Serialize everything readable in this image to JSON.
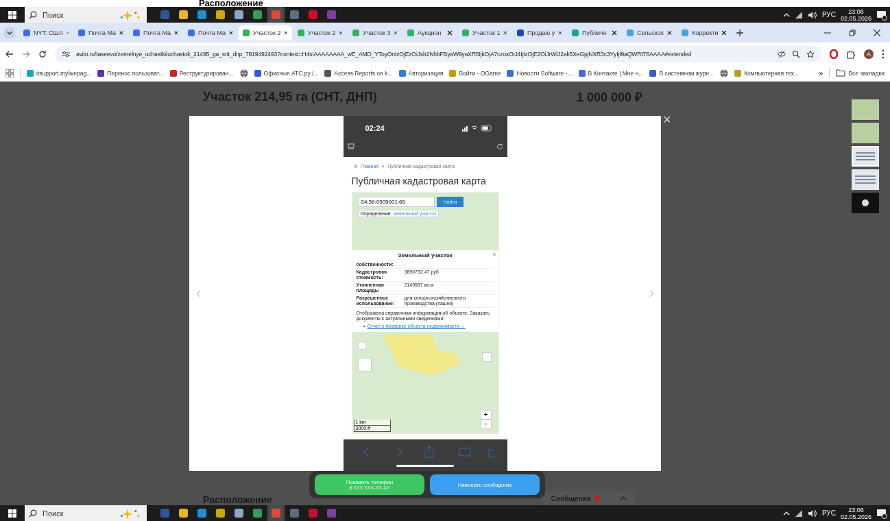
{
  "top_strip": {
    "heading": "Расположение"
  },
  "taskbars": [
    {
      "search_placeholder": "Поиск",
      "language": "РУС",
      "time": "23:06",
      "date": "02.05.2026",
      "apps": [
        {
          "color": "#2b5797",
          "selected": false
        },
        {
          "color": "#e8b62c",
          "selected": false
        },
        {
          "color": "#1e8fd0",
          "selected": false
        },
        {
          "color": "#c9a800",
          "selected": false
        },
        {
          "color": "#8aa6c8",
          "selected": false
        },
        {
          "color": "#3a9a5b",
          "selected": false
        },
        {
          "color": "#dc4a38",
          "selected": true
        },
        {
          "color": "#5b6e82",
          "selected": false
        },
        {
          "color": "#c8102e",
          "selected": false
        },
        {
          "color": "#7b3fa0",
          "selected": false
        }
      ]
    },
    {
      "search_placeholder": "Поиск",
      "language": "РУС",
      "time": "23:06",
      "date": "02.05.2026",
      "apps": [
        {
          "color": "#2b5797",
          "selected": false
        },
        {
          "color": "#e8b62c",
          "selected": false
        },
        {
          "color": "#1e8fd0",
          "selected": false
        },
        {
          "color": "#c9a800",
          "selected": false
        },
        {
          "color": "#8aa6c8",
          "selected": false
        },
        {
          "color": "#3a9a5b",
          "selected": false
        },
        {
          "color": "#dc4a38",
          "selected": true
        },
        {
          "color": "#5b6e82",
          "selected": false
        },
        {
          "color": "#c8102e",
          "selected": false
        },
        {
          "color": "#7b3fa0",
          "selected": false
        }
      ]
    }
  ],
  "browser": {
    "tabs": [
      {
        "label": "NYT: США",
        "color": "#3d6fe0",
        "selected": false
      },
      {
        "label": "Почта Ма",
        "color": "#3d6fe0",
        "selected": false
      },
      {
        "label": "Почта Ма",
        "color": "#3d6fe0",
        "selected": false
      },
      {
        "label": "Почта Ма",
        "color": "#3d6fe0",
        "selected": false
      },
      {
        "label": "Участок 2",
        "color": "#2fb35a",
        "selected": true
      },
      {
        "label": "Участок 2",
        "color": "#2fb35a",
        "selected": false
      },
      {
        "label": "Участок 3",
        "color": "#2fb35a",
        "selected": false
      },
      {
        "label": "Аукцион",
        "color": "#2fb35a",
        "selected": false
      },
      {
        "label": "Участок 1",
        "color": "#2fb35a",
        "selected": false
      },
      {
        "label": "Продаю у",
        "color": "#2140c8",
        "selected": false
      },
      {
        "label": "Публичн",
        "color": "#19a39a",
        "selected": false
      },
      {
        "label": "Сельскох",
        "color": "#4aa3df",
        "selected": false
      },
      {
        "label": "Корректи",
        "color": "#4aa3df",
        "selected": false
      }
    ],
    "url": "avito.ru/taseevo/zemelnye_uchastki/uchastok_21495_ga_snt_dnp_7919492493?context=H4sIAAAAAAAA_wE_AMD_YToyOntzOjEzOiJsb2NhbFByaW9yaXR5IjtiOjA7czoxOiJ4IjtzOjE2OiJrWlJ2ak5XeGpjNXR3c3YyIjt9aQWRtT8AAAA#extended",
    "profile": "A",
    "bookmarks": [
      {
        "kind": "link",
        "label": "itsupport.mylivepag...",
        "color": "#1aa3c8"
      },
      {
        "kind": "link",
        "label": "Перенос пользоват...",
        "color": "#5b2fc9"
      },
      {
        "kind": "link",
        "label": "Реструктурирован...",
        "color": "#c62828"
      },
      {
        "kind": "globe",
        "color": "#555555"
      },
      {
        "kind": "link",
        "label": "Офисные АТС.ру /...",
        "color": "#3a55d6"
      },
      {
        "kind": "link",
        "label": "Access Reports on k...",
        "color": "#555555"
      },
      {
        "kind": "link",
        "label": "Авторизация",
        "color": "#2f7fd8"
      },
      {
        "kind": "link",
        "label": "Войти - OGame",
        "color": "#c79a10"
      },
      {
        "kind": "link",
        "label": "Новости Software -...",
        "color": "#3b6fd6"
      },
      {
        "kind": "link",
        "label": "В Контакте | Мне н...",
        "color": "#3f6fd8"
      },
      {
        "kind": "link",
        "label": "В системном журн...",
        "color": "#3a5fc0"
      },
      {
        "kind": "globe",
        "color": "#555555"
      },
      {
        "kind": "link",
        "label": "Компьютерная тех...",
        "color": "#b8a020"
      }
    ],
    "more": "»",
    "all_bookmarks": "Все закладки"
  },
  "page": {
    "title": "Участок 214,95 га (СНТ, ДНП)",
    "price": "1 000 000 ₽",
    "location_heading": "Расположение",
    "messages": "Сообщения"
  },
  "gallery": {
    "prev": "‹",
    "next": "›",
    "close": "×",
    "thumbnails": [
      {
        "kind": "map",
        "selected": false
      },
      {
        "kind": "map",
        "selected": false
      },
      {
        "kind": "doc",
        "selected": true
      },
      {
        "kind": "doc",
        "selected": false
      },
      {
        "kind": "badge",
        "selected": false
      }
    ]
  },
  "phone": {
    "time": "02:24",
    "breadcrumb": [
      "Главная",
      "Публичная кадастровая карта"
    ],
    "heading": "Публичная кадастровая карта",
    "search_value": "24:36:0505001:65",
    "search_button": "Найти",
    "filter_label": "Определение:",
    "filter_value": "земельный участок",
    "popup": {
      "title": "Земельный участок",
      "close": "×",
      "rows": [
        {
          "label": "собственности:",
          "value": "-"
        },
        {
          "label": "Кадастровая стоимость:",
          "value": "3890752.47 руб"
        },
        {
          "label": "Уточненная площадь:",
          "value": "2149587 кв.м"
        },
        {
          "label": "Разрешенное использование:",
          "value": "для сельскохозяйственного производства (пашня)"
        }
      ],
      "note": "Отображена справочная информация об объекте. Заказать документы с актуальными сведениями:",
      "link": "Отчет о проверке объекта недвижимости →"
    },
    "scale": [
      "1 km",
      "3000 ft"
    ],
    "zoom_in": "+",
    "zoom_out": "−"
  },
  "contact": {
    "phone_button": "Показать телефон",
    "phone_hint": "8 XXX XXX-XX-XX",
    "message_button": "Написать сообщение"
  }
}
